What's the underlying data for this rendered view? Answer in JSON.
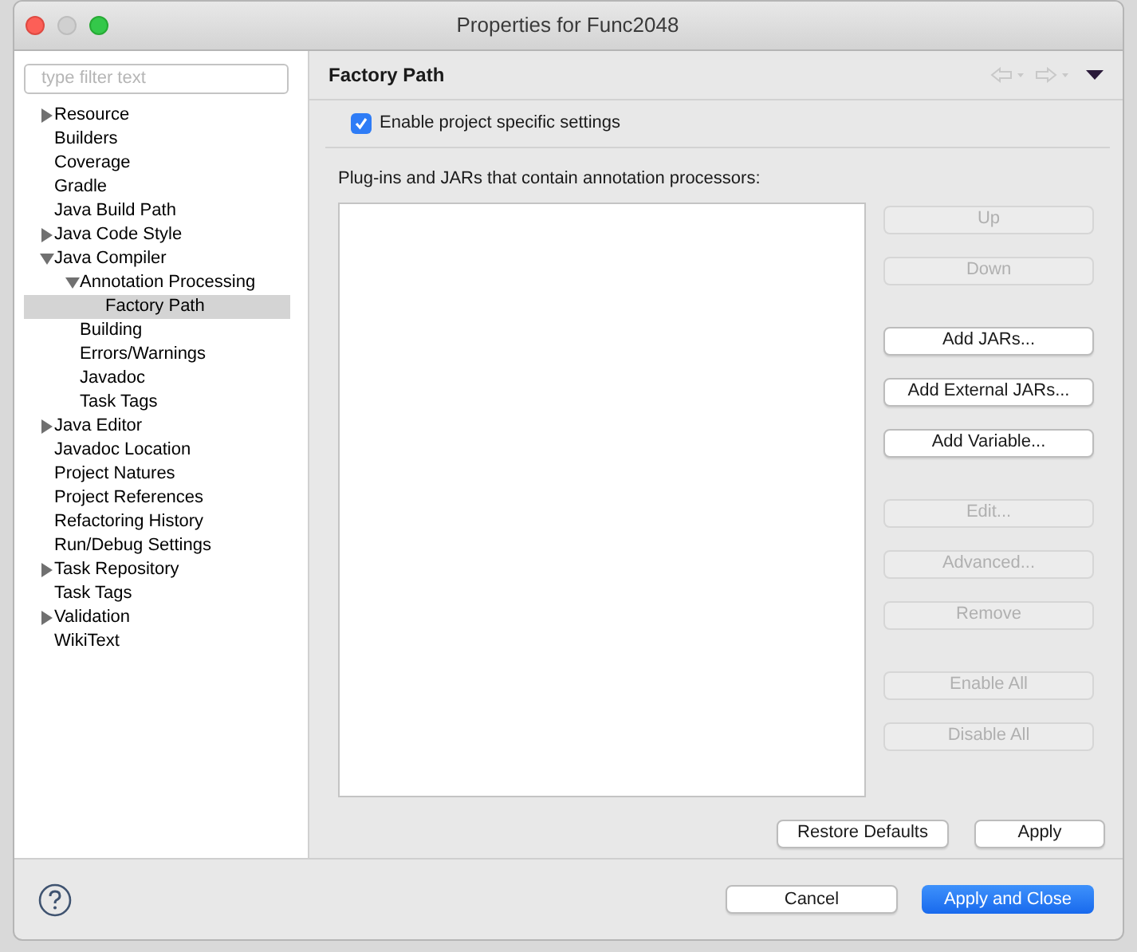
{
  "window": {
    "title": "Properties for Func2048"
  },
  "sidebar": {
    "filter": {
      "placeholder": "type filter text"
    },
    "tree": [
      {
        "label": "Resource",
        "expanded": false,
        "selected": false
      },
      {
        "label": "Builders",
        "selected": false
      },
      {
        "label": "Coverage",
        "selected": false
      },
      {
        "label": "Gradle",
        "selected": false
      },
      {
        "label": "Java Build Path",
        "selected": false
      },
      {
        "label": "Java Code Style",
        "expanded": false,
        "selected": false
      },
      {
        "label": "Java Compiler",
        "expanded": true,
        "selected": false,
        "children": [
          {
            "label": "Annotation Processing",
            "expanded": true,
            "selected": false,
            "children": [
              {
                "label": "Factory Path",
                "selected": true
              }
            ]
          },
          {
            "label": "Building",
            "selected": false
          },
          {
            "label": "Errors/Warnings",
            "selected": false
          },
          {
            "label": "Javadoc",
            "selected": false
          },
          {
            "label": "Task Tags",
            "selected": false
          }
        ]
      },
      {
        "label": "Java Editor",
        "expanded": false,
        "selected": false
      },
      {
        "label": "Javadoc Location",
        "selected": false
      },
      {
        "label": "Project Natures",
        "selected": false
      },
      {
        "label": "Project References",
        "selected": false
      },
      {
        "label": "Refactoring History",
        "selected": false
      },
      {
        "label": "Run/Debug Settings",
        "selected": false
      },
      {
        "label": "Task Repository",
        "expanded": false,
        "selected": false
      },
      {
        "label": "Task Tags",
        "selected": false
      },
      {
        "label": "Validation",
        "expanded": false,
        "selected": false
      },
      {
        "label": "WikiText",
        "selected": false
      }
    ]
  },
  "page": {
    "title": "Factory Path",
    "enable_checkbox": {
      "label": "Enable project specific settings",
      "checked": true
    },
    "list_label": "Plug-ins and JARs that contain annotation processors:",
    "button_groups": [
      [
        {
          "label": "Up",
          "disabled": true
        },
        {
          "label": "Down",
          "disabled": true
        }
      ],
      [
        {
          "label": "Add JARs...",
          "disabled": false
        },
        {
          "label": "Add External JARs...",
          "disabled": false
        },
        {
          "label": "Add Variable...",
          "disabled": false
        }
      ],
      [
        {
          "label": "Edit...",
          "disabled": true
        },
        {
          "label": "Advanced...",
          "disabled": true
        },
        {
          "label": "Remove",
          "disabled": true
        }
      ],
      [
        {
          "label": "Enable All",
          "disabled": true
        },
        {
          "label": "Disable All",
          "disabled": true
        }
      ]
    ],
    "restore_defaults": "Restore Defaults",
    "apply": "Apply"
  },
  "footer": {
    "cancel": "Cancel",
    "apply_and_close": "Apply and Close"
  }
}
